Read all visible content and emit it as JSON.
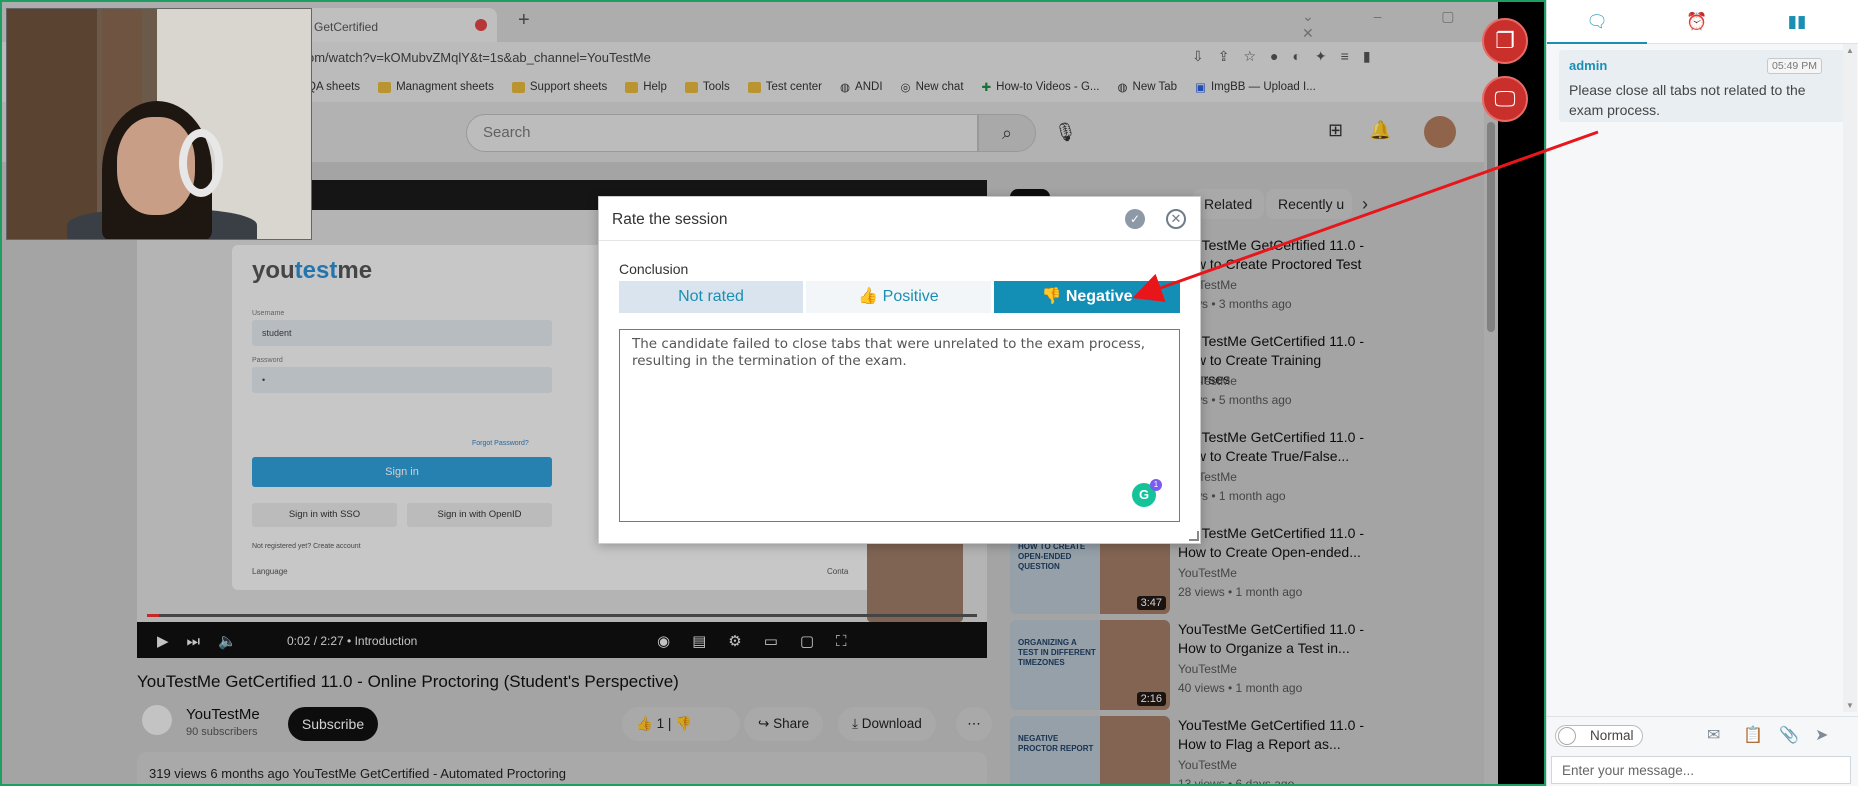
{
  "browser": {
    "tab_title": "GetCertified",
    "url": "om/watch?v=kOMubvZMqlY&t=1s&ab_channel=YouTestMe",
    "bookmarks": [
      "QA sheets",
      "Managment sheets",
      "Support sheets",
      "Help",
      "Tools",
      "Test center",
      "ANDI",
      "New chat",
      "How-to Videos - G...",
      "New Tab",
      "ImgBB — Upload I..."
    ]
  },
  "youtube": {
    "search_placeholder": "Search",
    "video": {
      "brand_you": "you",
      "brand_test": "test",
      "brand_me": "me",
      "username_label": "Username",
      "username_value": "student",
      "password_label": "Password",
      "password_value": "•",
      "forgot": "Forgot Password?",
      "sign_in": "Sign in",
      "sign_in_sso": "Sign in with SSO",
      "sign_in_openid": "Sign in with OpenID",
      "not_registered": "Not registered yet? Create account",
      "language": "Language",
      "contact": "Conta",
      "time": "0:02 / 2:27 • Introduction",
      "progress_fraction": 0.014
    },
    "title": "YouTestMe GetCertified 11.0 - Online Proctoring (Student's Perspective)",
    "channel": "YouTestMe",
    "subscribers": "90 subscribers",
    "subscribe": "Subscribe",
    "likes": "1",
    "share": "Share",
    "download": "Download",
    "description": "319 views  6 months ago  YouTestMe GetCertified - Automated Proctoring",
    "chips": [
      "Related",
      "Recently u"
    ],
    "recommended": [
      {
        "title": "YouTestMe GetCertified 11.0 - How to Create Proctored Test ...",
        "channel": "YouTestMe",
        "meta": "views • 3 months ago",
        "thumb": "",
        "duration": ""
      },
      {
        "title": "YouTestMe GetCertified 11.0 - How to Create Training Courses",
        "channel": "YouTestMe",
        "meta": "views • 5 months ago",
        "thumb": "",
        "duration": ""
      },
      {
        "title": "YouTestMe GetCertified 11.0 - How to Create True/False...",
        "channel": "YouTestMe",
        "meta": "views • 1 month ago",
        "thumb": "",
        "duration": ""
      },
      {
        "title": "YouTestMe GetCertified 11.0 - How to Create Open-ended...",
        "channel": "YouTestMe",
        "meta": "28 views • 1 month ago",
        "thumb": "HOW TO CREATE OPEN-ENDED QUESTION",
        "duration": "3:47"
      },
      {
        "title": "YouTestMe GetCertified 11.0 - How to Organize a Test in...",
        "channel": "YouTestMe",
        "meta": "40 views • 1 month ago",
        "thumb": "ORGANIZING A TEST IN DIFFERENT TIMEZONES",
        "duration": "2:16"
      },
      {
        "title": "YouTestMe GetCertified 11.0 - How to Flag a Report as...",
        "channel": "YouTestMe",
        "meta": "13 views • 6 days ago",
        "thumb": "NEGATIVE PROCTOR REPORT",
        "duration": ""
      }
    ]
  },
  "modal": {
    "title": "Rate the session",
    "conclusion_label": "Conclusion",
    "options": {
      "not_rated": "Not rated",
      "positive": "Positive",
      "negative": "Negative"
    },
    "selected": "negative",
    "comment": "The candidate failed to close tabs that were unrelated to the exam process, resulting in the termination of the exam.",
    "grammarly_count": "1"
  },
  "panel": {
    "messages": [
      {
        "author": "admin",
        "time": "05:49 PM",
        "text": "Please close all tabs not related to the exam process."
      }
    ],
    "mode_label": "Normal",
    "input_placeholder": "Enter your message..."
  },
  "colors": {
    "accent": "#138fb6",
    "annotation_arrow": "#e8161b",
    "overlay_button": "#c9302c",
    "screen_border": "#1e9e63"
  }
}
